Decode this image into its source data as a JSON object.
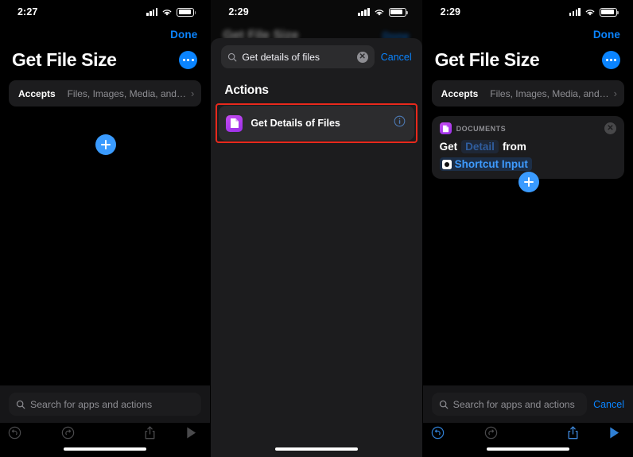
{
  "app": "Shortcuts",
  "panels": [
    {
      "id": "editor-initial",
      "status": {
        "time": "2:27",
        "signal_icon": "cellular-bars-icon",
        "wifi_icon": "wifi-icon",
        "battery_icon": "battery-icon"
      },
      "nav": {
        "done_label": "Done",
        "title": "Get File Size",
        "more_icon": "ellipsis-circle-icon"
      },
      "accepts": {
        "label": "Accepts",
        "value": "Files, Images, Media, and…",
        "chevron": "chevron-right-icon"
      },
      "add_action": {
        "icon": "plus-circle-icon"
      },
      "dock": {
        "search_placeholder": "Search for apps and actions",
        "search_icon": "search-icon"
      },
      "toolbar": {
        "undo": "undo-icon",
        "redo": "redo-icon",
        "share": "share-icon",
        "play": "play-icon",
        "enabled": false
      }
    },
    {
      "id": "action-search",
      "status": {
        "time": "2:29",
        "signal_icon": "cellular-bars-icon",
        "wifi_icon": "wifi-icon",
        "battery_icon": "battery-icon"
      },
      "blurred_nav": {
        "title": "Get File Size",
        "done_label": "Done"
      },
      "search": {
        "value": "Get details of files",
        "search_icon": "search-icon",
        "clear_icon": "clear-circle-icon",
        "cancel_label": "Cancel"
      },
      "section_header": "Actions",
      "results": [
        {
          "app_icon": "documents-app-icon",
          "label": "Get Details of Files",
          "info_icon": "info-circle-icon",
          "highlighted": true
        }
      ],
      "highlight_color": "#e8291c"
    },
    {
      "id": "editor-with-action",
      "status": {
        "time": "2:29",
        "signal_icon": "cellular-bars-icon",
        "wifi_icon": "wifi-icon",
        "battery_icon": "battery-icon"
      },
      "nav": {
        "done_label": "Done",
        "title": "Get File Size",
        "more_icon": "ellipsis-circle-icon"
      },
      "accepts": {
        "label": "Accepts",
        "value": "Files, Images, Media, and…",
        "chevron": "chevron-right-icon"
      },
      "action_card": {
        "app_icon": "documents-app-icon",
        "category": "DOCUMENTS",
        "close_icon": "close-circle-icon",
        "word_get": "Get",
        "token_detail": "Detail",
        "word_from": "from",
        "variable_icon": "shortcut-input-icon",
        "token_variable": "Shortcut Input"
      },
      "add_action": {
        "icon": "plus-circle-icon"
      },
      "dock": {
        "search_placeholder": "Search for apps and actions",
        "search_icon": "search-icon",
        "cancel_label": "Cancel"
      },
      "toolbar": {
        "undo": "undo-icon",
        "redo": "redo-icon",
        "share": "share-icon",
        "play": "play-icon",
        "enabled": true
      }
    }
  ],
  "colors": {
    "accent": "#0a84ff",
    "highlight": "#e8291c",
    "app_icon": "#9b30e8",
    "card_bg": "#1c1c1e"
  }
}
